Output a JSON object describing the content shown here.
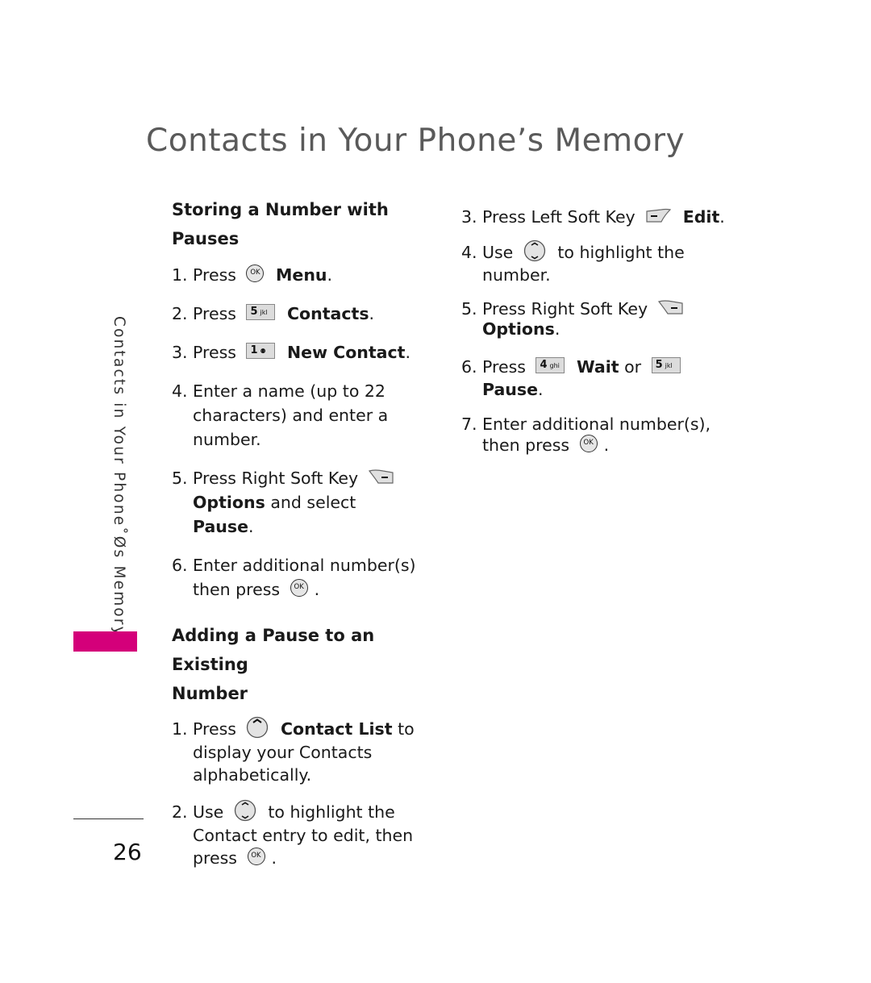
{
  "page": {
    "title": "Contacts in Your Phone’s Memory",
    "side_label": "Contacts in Your Phone˚Øs Memory",
    "page_number": "26",
    "accent_color": "#d4007a"
  },
  "section1": {
    "heading": "Storing a Number with Pauses",
    "steps": [
      {
        "num": "1.",
        "pre": "Press",
        "icon": "ok-key",
        "post_bold": "Menu",
        "post": "."
      },
      {
        "num": "2.",
        "pre": "Press",
        "icon": "key-5",
        "icon_main": "5",
        "icon_sub": "jkl",
        "post_bold": "Contacts",
        "post": "."
      },
      {
        "num": "3.",
        "pre": "Press",
        "icon": "key-1",
        "icon_main": "1",
        "icon_sub": "⚉",
        "post_bold": "New Contact",
        "post": "."
      },
      {
        "num": "4.",
        "text": "Enter a name (up to 22 characters) and enter a number."
      },
      {
        "num": "5.",
        "pre": "Press Right Soft Key",
        "icon": "right-soft-key",
        "bold1": "Options",
        "mid": " and select ",
        "bold2": "Pause",
        "post": "."
      },
      {
        "num": "6.",
        "pre": "Enter additional number(s) then press",
        "icon": "ok-key",
        "post": "."
      }
    ]
  },
  "section2": {
    "heading_line1": "Adding a Pause to an Existing",
    "heading_line2": "Number",
    "steps": [
      {
        "num": "1.",
        "pre": "Press",
        "icon": "nav-up-key",
        "post_bold": "Contact List",
        "post": " to display your Contacts alphabetically."
      },
      {
        "num": "2.",
        "pre": "Use",
        "icon": "nav-updown-key",
        "post": " to highlight the Contact entry to edit, then press",
        "icon2": "ok-key",
        "end": "."
      },
      {
        "num": "3.",
        "pre": "Press Left Soft Key",
        "icon": "left-soft-key",
        "post_bold": "Edit",
        "post": "."
      },
      {
        "num": "4.",
        "pre": "Use",
        "icon": "nav-updown-key",
        "post": " to highlight the number."
      },
      {
        "num": "5.",
        "pre": "Press Right Soft Key",
        "icon": "right-soft-key",
        "post_bold": "Options",
        "post": "."
      },
      {
        "num": "6.",
        "pre": "Press",
        "icon": "key-4",
        "icon_main": "4",
        "icon_sub": "ghi",
        "bold1": "Wait",
        "mid": " or ",
        "icon2": "key-5",
        "icon2_main": "5",
        "icon2_sub": "jkl",
        "bold2": "Pause",
        "post": "."
      },
      {
        "num": "7.",
        "pre": "Enter additional number(s), then press",
        "icon": "ok-key",
        "post": "."
      }
    ]
  },
  "icons": {
    "ok_label": "OK"
  }
}
